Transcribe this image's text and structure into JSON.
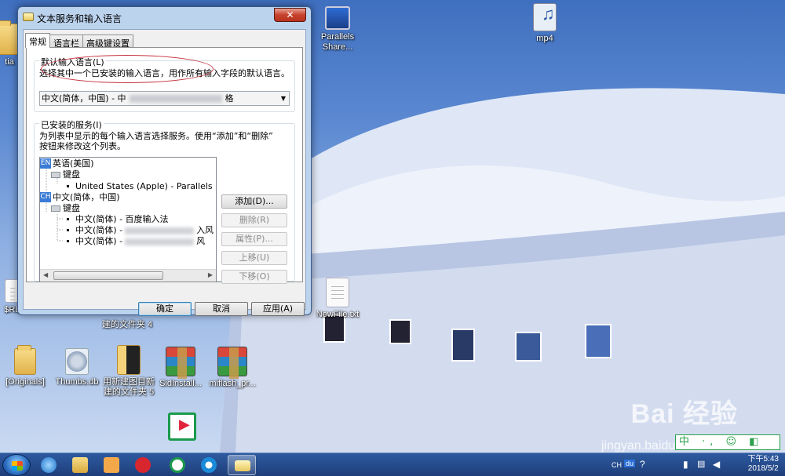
{
  "dialog": {
    "title": "文本服务和输入语言",
    "close_glyph": "✕",
    "tabs": [
      {
        "label": "常规"
      },
      {
        "label": "语言栏"
      },
      {
        "label": "高级键设置"
      }
    ],
    "default_lang": {
      "group_label": "默认输入语言(L)",
      "description": "选择其中一个已安装的输入语言，用作所有输入字段的默认语言。",
      "selected_prefix": "中文(简体，中国) - 中",
      "selected_suffix": "格"
    },
    "installed": {
      "group_label": "已安装的服务(I)",
      "description_line1": "为列表中显示的每个输入语言选择服务。使用“添加”和“删除”",
      "description_line2": "按钮来修改这个列表。",
      "tree": [
        {
          "badge": "EN",
          "label": "英语(美国)"
        },
        {
          "label": "键盘"
        },
        {
          "label": "United States (Apple) - Parallels"
        },
        {
          "badge": "CH",
          "label": "中文(简体，中国)"
        },
        {
          "label": "键盘"
        },
        {
          "label": "中文(简体) - 百度输入法"
        },
        {
          "label": "中文(简体) -",
          "tail": "入风"
        },
        {
          "label": "中文(简体) -",
          "tail": "风"
        }
      ],
      "buttons": {
        "add": "添加(D)...",
        "remove": "删除(R)",
        "properties": "属性(P)...",
        "move_up": "上移(U)",
        "move_down": "下移(O)"
      }
    },
    "footer": {
      "ok": "确定",
      "cancel": "取消",
      "apply": "应用(A)"
    }
  },
  "desktop_icons": {
    "tia": "tia",
    "parallels": "Parallels Share...",
    "mp4": "mp4",
    "rec": "$RE",
    "newfile": "NewFile.txt",
    "folder4": "建的文件夹 4",
    "originals": "[Originals]",
    "thumbs": "Thumbs.db",
    "folder5_line1": "用新建图目新",
    "folder5_line2": "建的文件夹 5",
    "sidinstall": "SidInstall...",
    "miflash": "miflash_pr..."
  },
  "taskbar": {
    "tray_lang": "CH",
    "tray_ime": "du",
    "time": "下午5:43",
    "date": "2018/5/2"
  },
  "watermark": {
    "logo": "Bai 经验",
    "url": "jingyan.baidu.com"
  },
  "ime_status": "中 ·, ☺ ◧",
  "colors": {
    "accent_red": "#c5303c",
    "selection_blue": "#3a7bd5",
    "taskbar": "#1e3e7a"
  }
}
